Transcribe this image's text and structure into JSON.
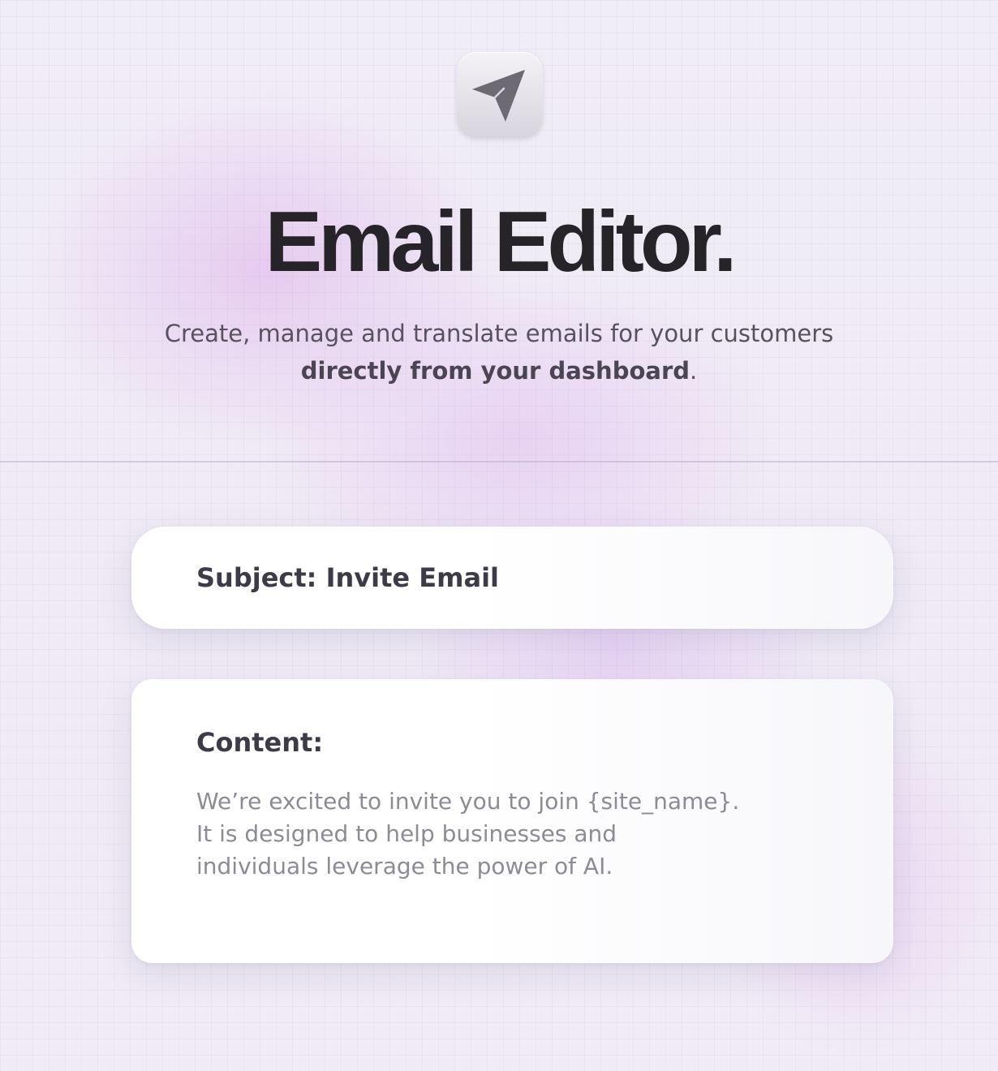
{
  "header": {
    "logo_icon": "paper-plane-icon",
    "title": "Email Editor.",
    "subtitle_line1": "Create, manage and translate emails for your customers",
    "subtitle_bold": "directly from your dashboard",
    "subtitle_end": "."
  },
  "subject_card": {
    "text": "Subject: Invite Email"
  },
  "content_card": {
    "label": "Content:",
    "lines": [
      "We’re excited to invite you to join {site_name}.",
      "It is designed to help businesses and",
      "individuals leverage the power of AI."
    ]
  },
  "colors": {
    "title": "#262428",
    "subtitle": "#57525f",
    "card_label": "#3e3b48",
    "card_body": "#8e8a96",
    "background": "#efeaf6"
  }
}
